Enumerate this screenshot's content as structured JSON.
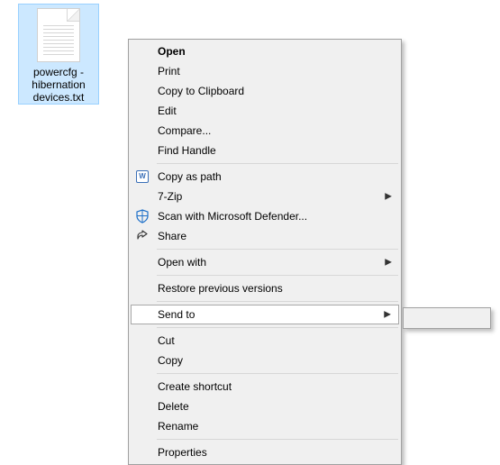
{
  "file": {
    "name": "powercfg -hibernation devices.txt"
  },
  "menu": {
    "open": "Open",
    "print": "Print",
    "copy_clipboard": "Copy to Clipboard",
    "edit": "Edit",
    "compare": "Compare...",
    "find_handle": "Find Handle",
    "copy_as_path": "Copy as path",
    "seven_zip": "7-Zip",
    "defender": "Scan with Microsoft Defender...",
    "share": "Share",
    "open_with": "Open with",
    "restore_prev": "Restore previous versions",
    "send_to": "Send to",
    "cut": "Cut",
    "copy": "Copy",
    "create_shortcut": "Create shortcut",
    "delete": "Delete",
    "rename": "Rename",
    "properties": "Properties"
  },
  "icons": {
    "w": "W"
  }
}
